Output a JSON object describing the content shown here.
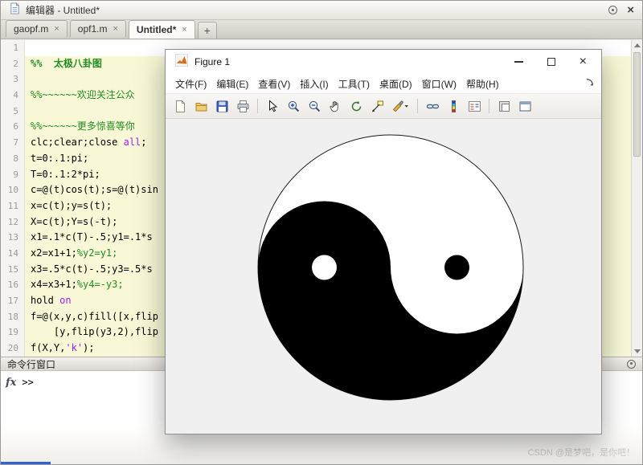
{
  "window": {
    "title": "编辑器 - Untitled*",
    "close_glyph": "×"
  },
  "editor_tabs": {
    "tabs": [
      {
        "label": "gaopf.m",
        "active": false
      },
      {
        "label": "opf1.m",
        "active": false
      },
      {
        "label": "Untitled*",
        "active": true
      }
    ],
    "close_glyph": "×",
    "new_tab_label": "+"
  },
  "editor": {
    "lines": [
      {
        "num": 1,
        "hl": false,
        "segs": []
      },
      {
        "num": 2,
        "hl": true,
        "segs": [
          {
            "t": "%%  太极八卦图",
            "c": "section"
          }
        ]
      },
      {
        "num": 3,
        "hl": true,
        "segs": []
      },
      {
        "num": 4,
        "hl": true,
        "segs": [
          {
            "t": "%%~~~~~~欢迎关注公众",
            "c": "comment"
          }
        ]
      },
      {
        "num": 5,
        "hl": true,
        "segs": []
      },
      {
        "num": 6,
        "hl": true,
        "segs": [
          {
            "t": "%%~~~~~~更多惊喜等你",
            "c": "comment"
          }
        ]
      },
      {
        "num": 7,
        "hl": true,
        "segs": [
          {
            "t": "clc;clear;close ",
            "c": "plain"
          },
          {
            "t": "all",
            "c": "str"
          },
          {
            "t": ";",
            "c": "plain"
          }
        ]
      },
      {
        "num": 8,
        "hl": true,
        "segs": [
          {
            "t": "t=0:.1:pi;",
            "c": "plain"
          }
        ]
      },
      {
        "num": 9,
        "hl": true,
        "segs": [
          {
            "t": "T=0:.1:2*pi;",
            "c": "plain"
          }
        ]
      },
      {
        "num": 10,
        "hl": true,
        "segs": [
          {
            "t": "c=@(t)cos(t);s=@(t)sin",
            "c": "plain"
          }
        ]
      },
      {
        "num": 11,
        "hl": true,
        "segs": [
          {
            "t": "x=c(t);y=s(t);",
            "c": "plain"
          }
        ]
      },
      {
        "num": 12,
        "hl": true,
        "segs": [
          {
            "t": "X=c(t);Y=s(-t);",
            "c": "plain"
          }
        ]
      },
      {
        "num": 13,
        "hl": true,
        "segs": [
          {
            "t": "x1=.1*c(T)-.5;y1=.1*s",
            "c": "plain"
          }
        ]
      },
      {
        "num": 14,
        "hl": true,
        "segs": [
          {
            "t": "x2=x1+1;",
            "c": "plain"
          },
          {
            "t": "%y2=y1;",
            "c": "comment"
          }
        ]
      },
      {
        "num": 15,
        "hl": true,
        "segs": [
          {
            "t": "x3=.5*c(t)-.5;y3=.5*s",
            "c": "plain"
          }
        ]
      },
      {
        "num": 16,
        "hl": true,
        "segs": [
          {
            "t": "x4=x3+1;",
            "c": "plain"
          },
          {
            "t": "%y4=-y3;",
            "c": "comment"
          }
        ]
      },
      {
        "num": 17,
        "hl": true,
        "segs": [
          {
            "t": "hold ",
            "c": "plain"
          },
          {
            "t": "on",
            "c": "str"
          }
        ]
      },
      {
        "num": 18,
        "hl": true,
        "segs": [
          {
            "t": "f=@(x,y,c)fill([x,flip",
            "c": "plain"
          }
        ]
      },
      {
        "num": 19,
        "hl": true,
        "segs": [
          {
            "t": "    [y,flip(y3,2),flip",
            "c": "plain"
          }
        ]
      },
      {
        "num": 20,
        "hl": true,
        "segs": [
          {
            "t": "f(X,Y,",
            "c": "plain"
          },
          {
            "t": "'k'",
            "c": "str"
          },
          {
            "t": ");",
            "c": "plain"
          }
        ]
      }
    ]
  },
  "command_window": {
    "header": "命令行窗口",
    "fx_label": "fx",
    "prompt": ">>"
  },
  "figure": {
    "title": "Figure 1",
    "menu": [
      "文件(F)",
      "编辑(E)",
      "查看(V)",
      "插入(I)",
      "工具(T)",
      "桌面(D)",
      "窗口(W)",
      "帮助(H)"
    ],
    "toolbar": [
      "new-document",
      "open-file",
      "save",
      "print",
      "separator",
      "cursor-arrow",
      "zoom-in",
      "zoom-out",
      "pan-hand",
      "rotate-3d",
      "data-cursor",
      "brush",
      "separator",
      "link-plots",
      "insert-colorbar",
      "insert-legend",
      "separator",
      "dock-window",
      "window-layout"
    ]
  },
  "watermark": "CSDN @是梦吧，是你吧！",
  "colors": {
    "comment_green": "#228B22",
    "string_purple": "#A020F0",
    "section_highlight": "#f8f8d6",
    "figure_canvas": "#f0f0f0",
    "taiji_black": "#000000",
    "taiji_white": "#ffffff"
  }
}
